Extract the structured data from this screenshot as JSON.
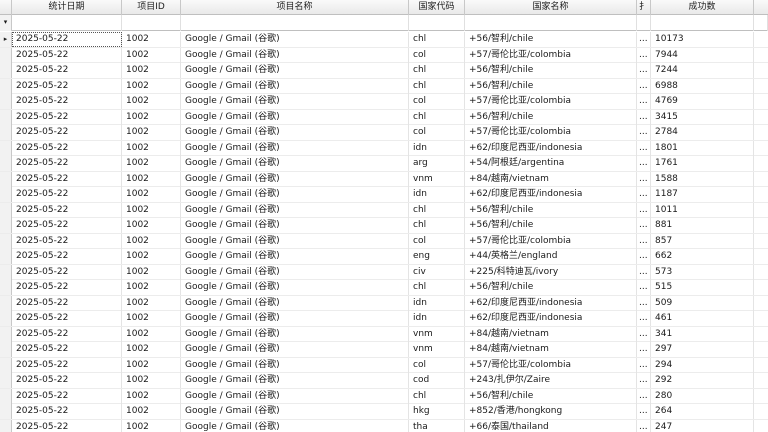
{
  "columns": {
    "date": "统计日期",
    "project_id": "项目ID",
    "project_name": "项目名称",
    "country_code": "国家代码",
    "country_name": "国家名称",
    "truncated": "扌",
    "success": "成功数"
  },
  "filter_icon": "▾",
  "row_indicator": "▸",
  "truncated_marker": "...",
  "rows": [
    {
      "date": "2025-05-22",
      "pid": "1002",
      "pname": "Google / Gmail (谷歌)",
      "cc": "chl",
      "cname": "+56/智利/chile",
      "success": "10173"
    },
    {
      "date": "2025-05-22",
      "pid": "1002",
      "pname": "Google / Gmail (谷歌)",
      "cc": "col",
      "cname": "+57/哥伦比亚/colombia",
      "success": "7944"
    },
    {
      "date": "2025-05-22",
      "pid": "1002",
      "pname": "Google / Gmail (谷歌)",
      "cc": "chl",
      "cname": "+56/智利/chile",
      "success": "7244"
    },
    {
      "date": "2025-05-22",
      "pid": "1002",
      "pname": "Google / Gmail (谷歌)",
      "cc": "chl",
      "cname": "+56/智利/chile",
      "success": "6988"
    },
    {
      "date": "2025-05-22",
      "pid": "1002",
      "pname": "Google / Gmail (谷歌)",
      "cc": "col",
      "cname": "+57/哥伦比亚/colombia",
      "success": "4769"
    },
    {
      "date": "2025-05-22",
      "pid": "1002",
      "pname": "Google / Gmail (谷歌)",
      "cc": "chl",
      "cname": "+56/智利/chile",
      "success": "3415"
    },
    {
      "date": "2025-05-22",
      "pid": "1002",
      "pname": "Google / Gmail (谷歌)",
      "cc": "col",
      "cname": "+57/哥伦比亚/colombia",
      "success": "2784"
    },
    {
      "date": "2025-05-22",
      "pid": "1002",
      "pname": "Google / Gmail (谷歌)",
      "cc": "idn",
      "cname": "+62/印度尼西亚/indonesia",
      "success": "1801"
    },
    {
      "date": "2025-05-22",
      "pid": "1002",
      "pname": "Google / Gmail (谷歌)",
      "cc": "arg",
      "cname": "+54/阿根廷/argentina",
      "success": "1761"
    },
    {
      "date": "2025-05-22",
      "pid": "1002",
      "pname": "Google / Gmail (谷歌)",
      "cc": "vnm",
      "cname": "+84/越南/vietnam",
      "success": "1588"
    },
    {
      "date": "2025-05-22",
      "pid": "1002",
      "pname": "Google / Gmail (谷歌)",
      "cc": "idn",
      "cname": "+62/印度尼西亚/indonesia",
      "success": "1187"
    },
    {
      "date": "2025-05-22",
      "pid": "1002",
      "pname": "Google / Gmail (谷歌)",
      "cc": "chl",
      "cname": "+56/智利/chile",
      "success": "1011"
    },
    {
      "date": "2025-05-22",
      "pid": "1002",
      "pname": "Google / Gmail (谷歌)",
      "cc": "chl",
      "cname": "+56/智利/chile",
      "success": "881"
    },
    {
      "date": "2025-05-22",
      "pid": "1002",
      "pname": "Google / Gmail (谷歌)",
      "cc": "col",
      "cname": "+57/哥伦比亚/colombia",
      "success": "857"
    },
    {
      "date": "2025-05-22",
      "pid": "1002",
      "pname": "Google / Gmail (谷歌)",
      "cc": "eng",
      "cname": "+44/英格兰/england",
      "success": "662"
    },
    {
      "date": "2025-05-22",
      "pid": "1002",
      "pname": "Google / Gmail (谷歌)",
      "cc": "civ",
      "cname": "+225/科特迪瓦/ivory",
      "success": "573"
    },
    {
      "date": "2025-05-22",
      "pid": "1002",
      "pname": "Google / Gmail (谷歌)",
      "cc": "chl",
      "cname": "+56/智利/chile",
      "success": "515"
    },
    {
      "date": "2025-05-22",
      "pid": "1002",
      "pname": "Google / Gmail (谷歌)",
      "cc": "idn",
      "cname": "+62/印度尼西亚/indonesia",
      "success": "509"
    },
    {
      "date": "2025-05-22",
      "pid": "1002",
      "pname": "Google / Gmail (谷歌)",
      "cc": "idn",
      "cname": "+62/印度尼西亚/indonesia",
      "success": "461"
    },
    {
      "date": "2025-05-22",
      "pid": "1002",
      "pname": "Google / Gmail (谷歌)",
      "cc": "vnm",
      "cname": "+84/越南/vietnam",
      "success": "341"
    },
    {
      "date": "2025-05-22",
      "pid": "1002",
      "pname": "Google / Gmail (谷歌)",
      "cc": "vnm",
      "cname": "+84/越南/vietnam",
      "success": "297"
    },
    {
      "date": "2025-05-22",
      "pid": "1002",
      "pname": "Google / Gmail (谷歌)",
      "cc": "col",
      "cname": "+57/哥伦比亚/colombia",
      "success": "294"
    },
    {
      "date": "2025-05-22",
      "pid": "1002",
      "pname": "Google / Gmail (谷歌)",
      "cc": "cod",
      "cname": "+243/扎伊尔/Zaire",
      "success": "292"
    },
    {
      "date": "2025-05-22",
      "pid": "1002",
      "pname": "Google / Gmail (谷歌)",
      "cc": "chl",
      "cname": "+56/智利/chile",
      "success": "280"
    },
    {
      "date": "2025-05-22",
      "pid": "1002",
      "pname": "Google / Gmail (谷歌)",
      "cc": "hkg",
      "cname": "+852/香港/hongkong",
      "success": "264"
    },
    {
      "date": "2025-05-22",
      "pid": "1002",
      "pname": "Google / Gmail (谷歌)",
      "cc": "tha",
      "cname": "+66/泰国/thailand",
      "success": "247"
    }
  ]
}
